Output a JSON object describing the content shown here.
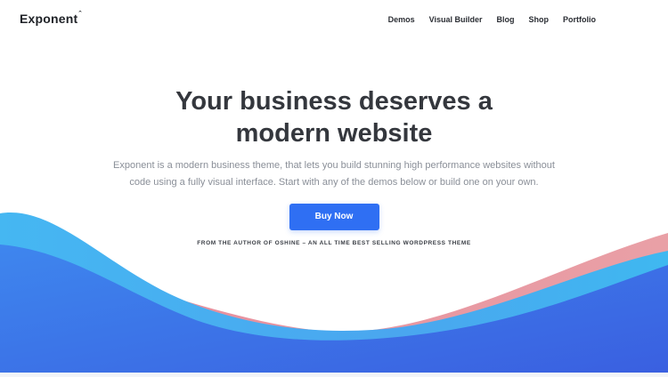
{
  "header": {
    "logo": "Exponent",
    "logo_mark": "ˆ",
    "nav": [
      "Demos",
      "Visual Builder",
      "Blog",
      "Shop",
      "Portfolio"
    ]
  },
  "hero": {
    "title": "Your business deserves a modern website",
    "description": "Exponent is a modern business theme, that lets you build stunning high performance websites without code using a fully visual interface. Start with any of the demos below or build one on your own.",
    "button": "Buy Now",
    "tagline": "FROM THE AUTHOR OF OSHINE – AN ALL TIME BEST SELLING WORDPRESS THEME"
  },
  "colors": {
    "accent": "#2f6ff3",
    "wave_blue": "#3c6fe8",
    "wave_cyan": "#39b4f0",
    "wave_pink": "#e89aa3"
  }
}
